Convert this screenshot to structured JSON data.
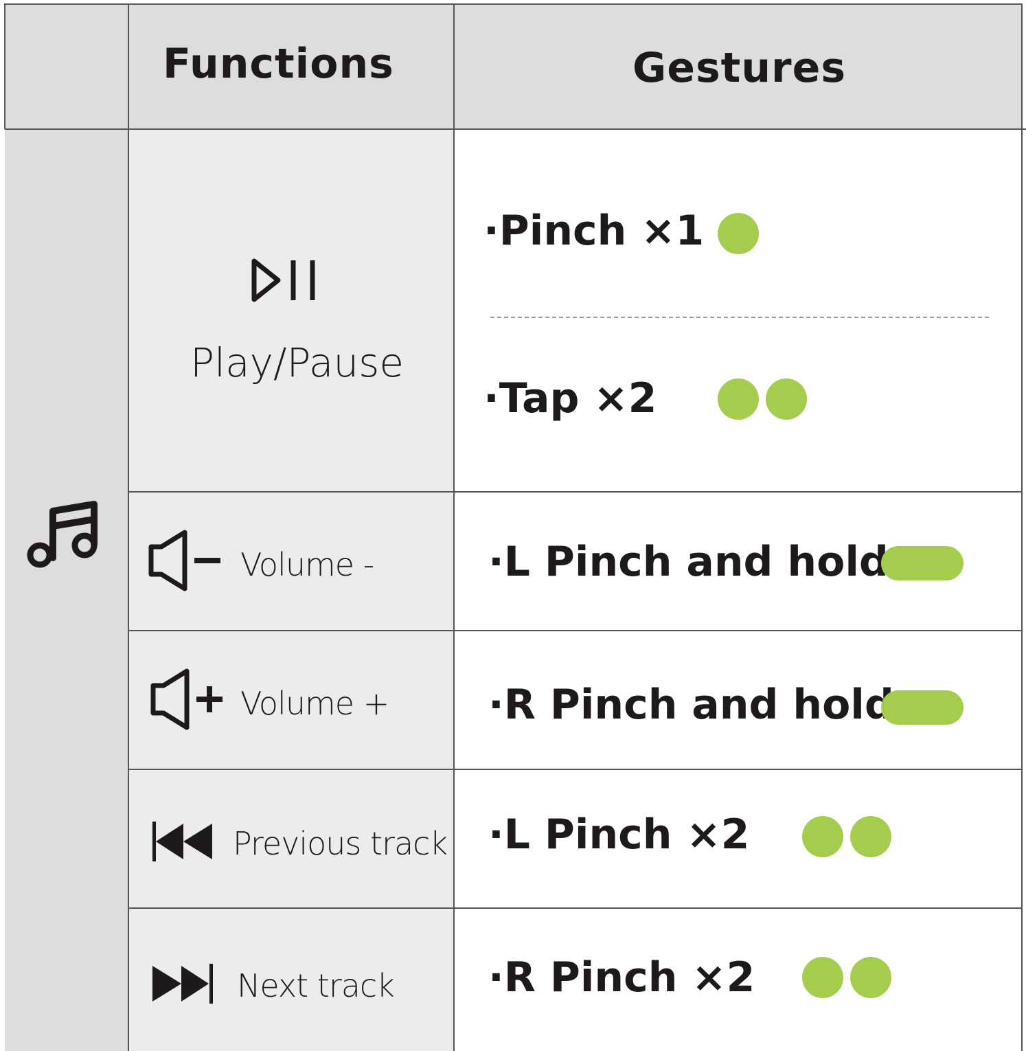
{
  "header": {
    "col_functions": "Functions",
    "col_gestures": "Gestures"
  },
  "category": {
    "icon": "music-note-icon"
  },
  "rows": [
    {
      "icon": "play-pause-icon",
      "function": "Play/Pause",
      "gestures": [
        {
          "label": "·Pinch ×1",
          "indicator": "single-dot"
        },
        {
          "label": "·Tap ×2",
          "indicator": "double-dot"
        }
      ]
    },
    {
      "icon": "volume-down-icon",
      "function": "Volume -",
      "gestures": [
        {
          "label": "·L Pinch and hold",
          "indicator": "long-pill"
        }
      ]
    },
    {
      "icon": "volume-up-icon",
      "function": "Volume +",
      "gestures": [
        {
          "label": "·R Pinch and hold",
          "indicator": "long-pill"
        }
      ]
    },
    {
      "icon": "previous-track-icon",
      "function": "Previous track",
      "gestures": [
        {
          "label": "·L Pinch ×2",
          "indicator": "double-dot"
        }
      ]
    },
    {
      "icon": "next-track-icon",
      "function": "Next track",
      "gestures": [
        {
          "label": "·R Pinch ×2",
          "indicator": "double-dot"
        }
      ]
    }
  ],
  "colors": {
    "indicator": "#a5cd4d",
    "header_bg": "#dcdddc",
    "function_bg": "#ececec",
    "text": "#1e1a1b"
  }
}
